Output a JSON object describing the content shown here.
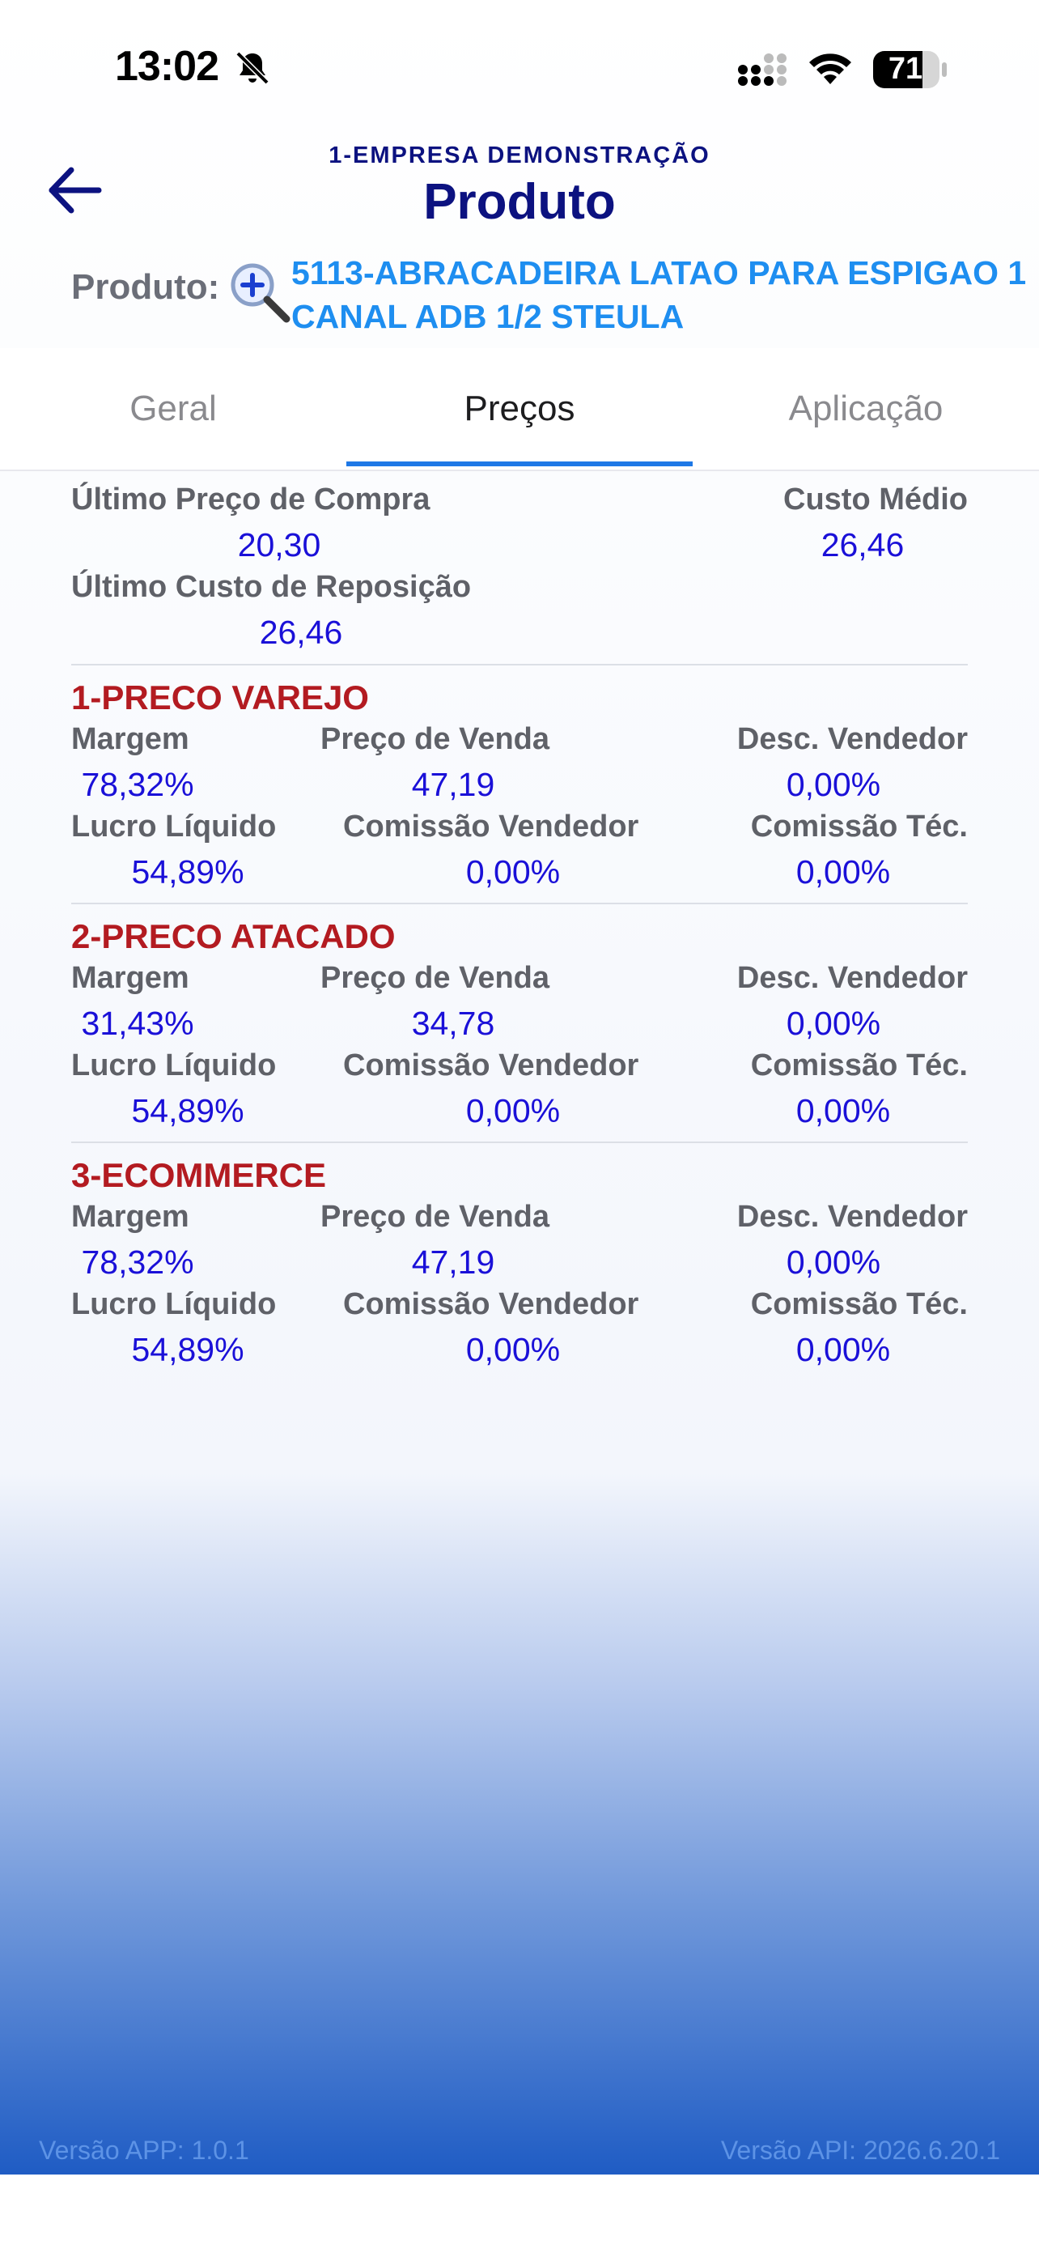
{
  "status_bar": {
    "time": "13:02",
    "battery": "71"
  },
  "header": {
    "company": "1-EMPRESA DEMONSTRAÇÃO",
    "title": "Produto",
    "product_label": "Produto:",
    "product_line1": "5113-ABRACADEIRA LATAO PARA ESPIGAO 1",
    "product_line2": "CANAL ADB 1/2 STEULA"
  },
  "tabs": [
    {
      "label": "Geral",
      "active": false
    },
    {
      "label": "Preços",
      "active": true
    },
    {
      "label": "Aplicação",
      "active": false
    }
  ],
  "costs": {
    "last_purchase_label": "Último Preço de Compra",
    "last_purchase_value": "20,30",
    "avg_cost_label": "Custo Médio",
    "avg_cost_value": "26,46",
    "replacement_label": "Último Custo de Reposição",
    "replacement_value": "26,46"
  },
  "labels": {
    "margin": "Margem",
    "sale_price": "Preço de Venda",
    "seller_discount": "Desc. Vendedor",
    "net_profit": "Lucro Líquido",
    "seller_commission": "Comissão Vendedor",
    "tech_commission": "Comissão Téc."
  },
  "price_tables": [
    {
      "name": "1-PRECO VAREJO",
      "margin": "78,32%",
      "sale_price": "47,19",
      "seller_discount": "0,00%",
      "net_profit": "54,89%",
      "seller_commission": "0,00%",
      "tech_commission": "0,00%"
    },
    {
      "name": "2-PRECO ATACADO",
      "margin": "31,43%",
      "sale_price": "34,78",
      "seller_discount": "0,00%",
      "net_profit": "54,89%",
      "seller_commission": "0,00%",
      "tech_commission": "0,00%"
    },
    {
      "name": "3-ECOMMERCE",
      "margin": "78,32%",
      "sale_price": "47,19",
      "seller_discount": "0,00%",
      "net_profit": "54,89%",
      "seller_commission": "0,00%",
      "tech_commission": "0,00%"
    }
  ],
  "footer": {
    "app_version": "Versão APP: 1.0.1",
    "api_version": "Versão API: 2026.6.20.1"
  }
}
